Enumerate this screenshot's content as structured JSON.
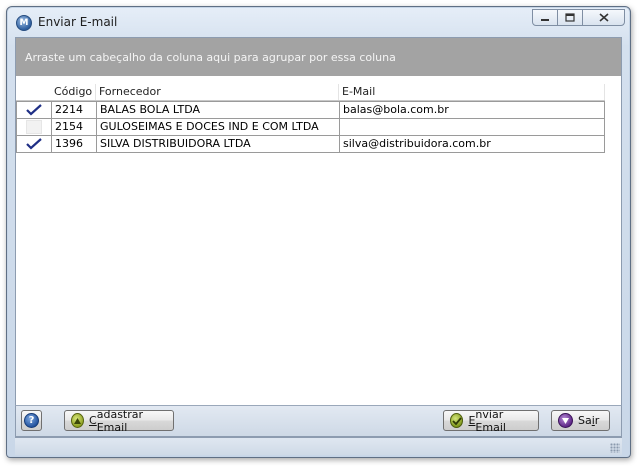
{
  "window": {
    "title": "Enviar E-mail",
    "icon": "app-logo-icon",
    "caption_buttons": [
      "minimize-icon",
      "maximize-icon",
      "close-icon"
    ]
  },
  "group_panel": {
    "hint": "Arraste um cabeçalho da coluna aqui para agrupar por essa coluna"
  },
  "grid": {
    "columns": [
      "",
      "Código",
      "Fornecedor",
      "E-Mail"
    ],
    "rows": [
      {
        "checked": true,
        "codigo": "2214",
        "fornecedor": "BALAS BOLA LTDA",
        "email": "balas@bola.com.br"
      },
      {
        "checked": false,
        "codigo": "2154",
        "fornecedor": "GULOSEIMAS E DOCES IND E COM LTDA",
        "email": ""
      },
      {
        "checked": true,
        "codigo": "1396",
        "fornecedor": "SILVA DISTRIBUIDORA LTDA",
        "email": "silva@distribuidora.com.br"
      }
    ]
  },
  "buttons": {
    "help_icon": "help-icon",
    "cadastrar": {
      "accel": "C",
      "rest": "adastrar Email",
      "icon": "add-circle-icon"
    },
    "enviar": {
      "accel": "E",
      "rest": "nviar Email",
      "icon": "check-circle-icon"
    },
    "sair": {
      "pre": "Sa",
      "accel": "i",
      "rest": "r",
      "icon": "down-circle-icon"
    }
  },
  "colors": {
    "group_panel_bg": "#a3a3a3",
    "check_mark": "#1f2f86",
    "window_frame": "#c9d7e8"
  }
}
